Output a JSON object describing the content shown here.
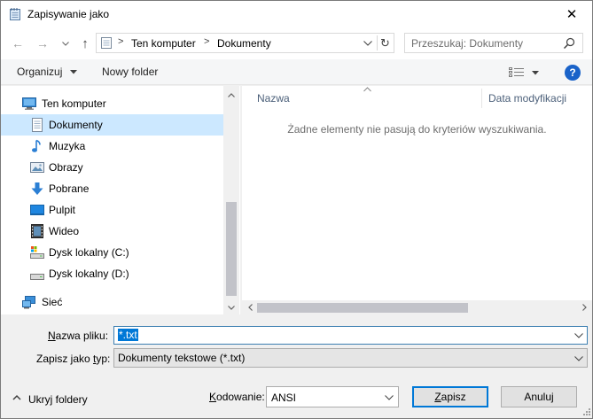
{
  "window": {
    "title": "Zapisywanie jako",
    "close_glyph": "✕"
  },
  "address": {
    "back_glyph": "←",
    "forward_glyph": "→",
    "up_glyph": "↑",
    "refresh_glyph": "↻",
    "breadcrumbs": [
      "Ten komputer",
      "Dokumenty"
    ],
    "separator": ">"
  },
  "search": {
    "placeholder": "Przeszukaj: Dokumenty"
  },
  "toolbar": {
    "organize_label": "Organizuj",
    "new_folder_label": "Nowy folder",
    "help_glyph": "?"
  },
  "nav": {
    "items": [
      {
        "label": "Ten komputer",
        "icon": "computer-icon"
      },
      {
        "label": "Dokumenty",
        "icon": "documents-icon",
        "selected": true
      },
      {
        "label": "Muzyka",
        "icon": "music-icon"
      },
      {
        "label": "Obrazy",
        "icon": "pictures-icon"
      },
      {
        "label": "Pobrane",
        "icon": "downloads-icon"
      },
      {
        "label": "Pulpit",
        "icon": "desktop-icon"
      },
      {
        "label": "Wideo",
        "icon": "videos-icon"
      },
      {
        "label": "Dysk lokalny (C:)",
        "icon": "drive-c-icon"
      },
      {
        "label": "Dysk lokalny (D:)",
        "icon": "drive-d-icon"
      },
      {
        "label": "Sieć",
        "icon": "network-icon"
      }
    ]
  },
  "content": {
    "col_name": "Nazwa",
    "col_date": "Data modyfikacji",
    "empty_message": "Żadne elementy nie pasują do kryteriów wyszukiwania."
  },
  "form": {
    "filename_label_prefix": "N",
    "filename_label_rest": "azwa pliku:",
    "filename_value": "*.txt",
    "filetype_label_prefix": "Zapisz jako ",
    "filetype_label_u": "t",
    "filetype_label_rest": "yp:",
    "filetype_value": "Dokumenty tekstowe (*.txt)",
    "hide_folders_label": "Ukryj foldery",
    "encoding_label_u": "K",
    "encoding_label_rest": "odowanie:",
    "encoding_value": "ANSI",
    "save_label_u": "Z",
    "save_label_rest": "apisz",
    "cancel_label": "Anuluj"
  },
  "colors": {
    "selection": "#cce8ff",
    "accent": "#0078d7"
  }
}
